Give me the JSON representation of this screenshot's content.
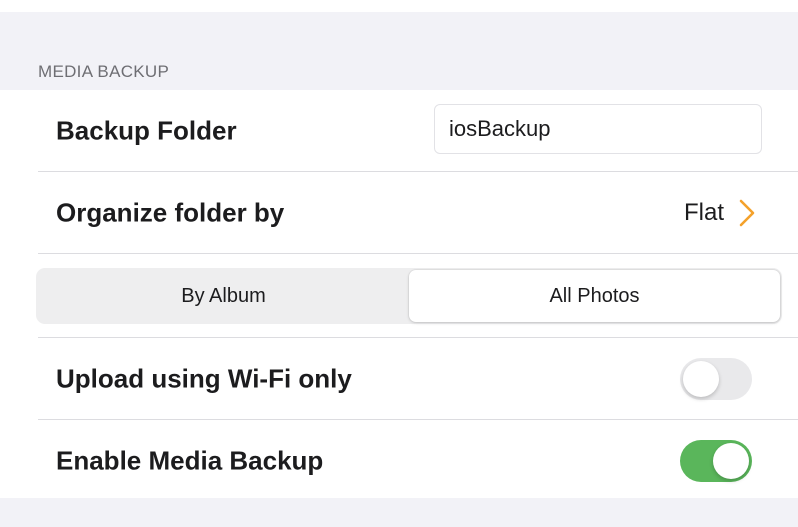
{
  "section": {
    "header": "MEDIA BACKUP"
  },
  "backup_folder": {
    "label": "Backup Folder",
    "value": "iosBackup"
  },
  "organize": {
    "label": "Organize folder by",
    "value": "Flat",
    "icon": "chevron-right-icon"
  },
  "segmented": {
    "options": [
      "By Album",
      "All Photos"
    ],
    "selected": "All Photos"
  },
  "wifi_only": {
    "label": "Upload using Wi-Fi only",
    "enabled": false
  },
  "media_backup": {
    "label": "Enable Media Backup",
    "enabled": true
  },
  "colors": {
    "accent": "#f4a12b",
    "toggle_on": "#5ab65b",
    "toggle_off": "#e9e9eb",
    "grouped_background": "#f2f2f7"
  }
}
